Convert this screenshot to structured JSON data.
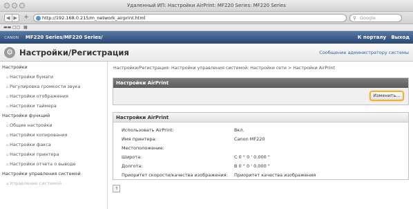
{
  "window": {
    "title": "Удаленный ИП: Настройки AirPrint: MF220 Series: MF220 Series"
  },
  "browser": {
    "url": "http://192.168.0.215/m_network_airprint.html",
    "search_placeholder": "Google",
    "back_label": "◀",
    "forward_label": "▶",
    "new_tab_label": "+",
    "reload_label": "C",
    "bookmarks": [
      "▬▬",
      "▢▢",
      "▦"
    ]
  },
  "header": {
    "brand": "ᴄᴀɴᴏɴ",
    "model": "MF220 Series/MF220 Series/",
    "portal_link": "К порталу",
    "logout_link": "Выход",
    "page_title": "Настройки/Регистрация",
    "admin_mail_link": "Сообщение администратору системы"
  },
  "sidebar": {
    "sections": [
      {
        "title": "Настройки",
        "items": [
          "Настройки бумаги",
          "Регулировка громкости звука",
          "Настройки отображения",
          "Настройки таймера"
        ]
      },
      {
        "title": "Настройки функций",
        "items": [
          "Общие настройки",
          "Настройки копирования",
          "Настройки факса",
          "Настройки принтера",
          "Настройки отчета о выводе"
        ]
      },
      {
        "title": "Настройки управления системой",
        "items": [
          "Управление системой"
        ]
      }
    ]
  },
  "breadcrumb": "Настройки/Регистрация: Настройки управления системой: Настройки сети > Настройки AirPrint",
  "airprint_panel": {
    "title": "Настройки AirPrint",
    "edit_button": "Изменить..."
  },
  "settings_panel": {
    "title": "Настройки AirPrint",
    "rows": [
      {
        "label": "Использовать AirPrint:",
        "value": "Вкл."
      },
      {
        "label": "Имя принтера:",
        "value": "Canon MF220"
      },
      {
        "label": "Местоположение:",
        "value": ""
      },
      {
        "label": "Широта:",
        "value": "С 0 ° 0 ' 0.000 \""
      },
      {
        "label": "Долгота:",
        "value": "В 0 ° 0 ' 0.000 \""
      },
      {
        "label": "Приоритет скорости/качества изображения:",
        "value": "Приоритет качества изображения"
      }
    ]
  },
  "to_top_label": "⇑"
}
